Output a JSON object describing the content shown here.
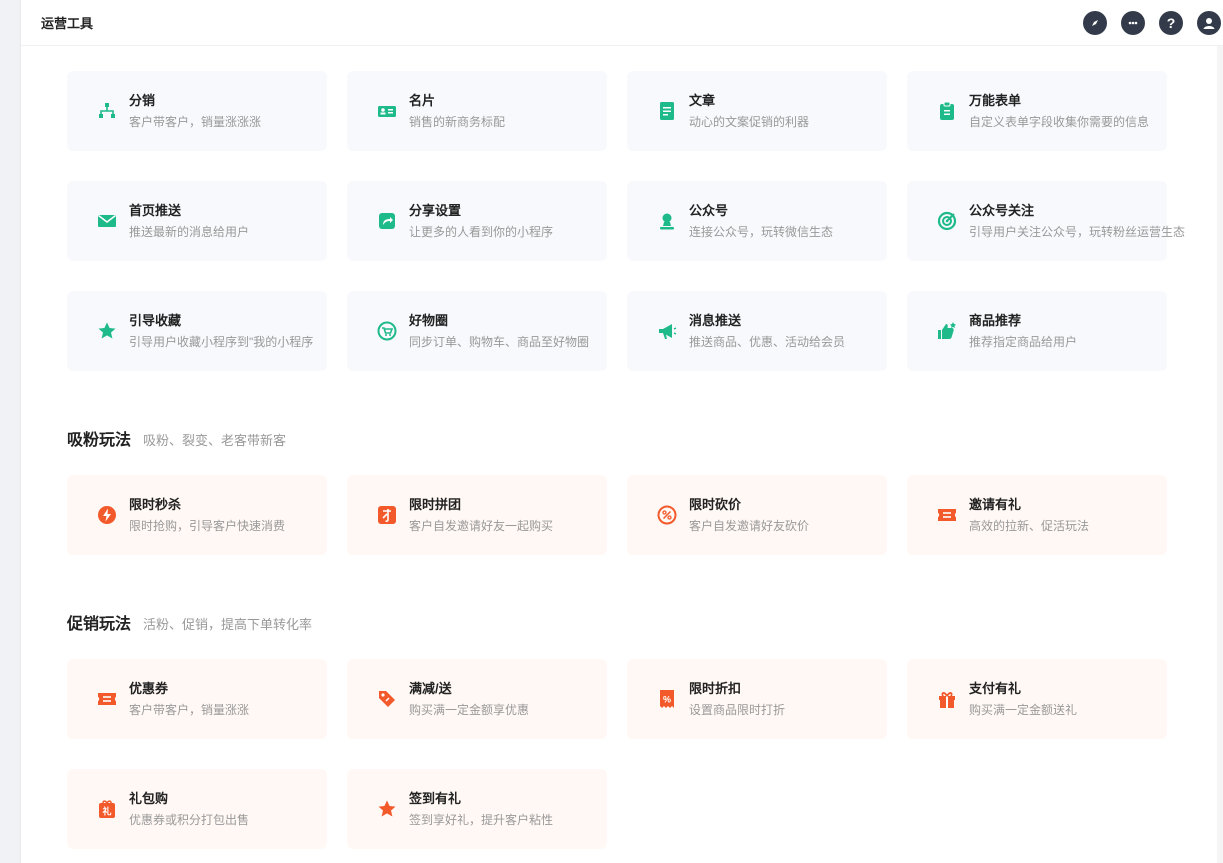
{
  "header": {
    "title": "运营工具"
  },
  "tools": [
    {
      "name": "分销",
      "desc": "客户带客户，销量涨涨涨",
      "icon": "org-chart-icon"
    },
    {
      "name": "名片",
      "desc": "销售的新商务标配",
      "icon": "business-card-icon"
    },
    {
      "name": "文章",
      "desc": "动心的文案促销的利器",
      "icon": "article-icon"
    },
    {
      "name": "万能表单",
      "desc": "自定义表单字段收集你需要的信息",
      "icon": "clipboard-icon"
    },
    {
      "name": "首页推送",
      "desc": "推送最新的消息给用户",
      "icon": "mail-icon"
    },
    {
      "name": "分享设置",
      "desc": "让更多的人看到你的小程序",
      "icon": "share-icon"
    },
    {
      "name": "公众号",
      "desc": "连接公众号，玩转微信生态",
      "icon": "official-account-icon"
    },
    {
      "name": "公众号关注",
      "desc": "引导用户关注公众号，玩转粉丝运营生态",
      "icon": "target-icon"
    },
    {
      "name": "引导收藏",
      "desc": "引导用户收藏小程序到\"我的小程序",
      "icon": "star-icon"
    },
    {
      "name": "好物圈",
      "desc": "同步订单、购物车、商品至好物圈",
      "icon": "cart-circle-icon"
    },
    {
      "name": "消息推送",
      "desc": "推送商品、优惠、活动给会员",
      "icon": "megaphone-icon"
    },
    {
      "name": "商品推荐",
      "desc": "推荐指定商品给用户",
      "icon": "thumbs-up-icon"
    }
  ],
  "fans": {
    "title": "吸粉玩法",
    "subtitle": "吸粉、裂变、老客带新客",
    "items": [
      {
        "name": "限时秒杀",
        "desc": "限时抢购，引导客户快速消费",
        "icon": "lightning-icon"
      },
      {
        "name": "限时拼团",
        "desc": "客户自发邀请好友一起购买",
        "icon": "group-buy-icon"
      },
      {
        "name": "限时砍价",
        "desc": "客户自发邀请好友砍价",
        "icon": "bargain-icon"
      },
      {
        "name": "邀请有礼",
        "desc": "高效的拉新、促活玩法",
        "icon": "ticket-icon"
      }
    ]
  },
  "promo": {
    "title": "促销玩法",
    "subtitle": "活粉、促销，提高下单转化率",
    "items": [
      {
        "name": "优惠券",
        "desc": "客户带客户，销量涨涨",
        "icon": "coupon-icon"
      },
      {
        "name": "满减/送",
        "desc": "购买满一定金额享优惠",
        "icon": "price-tag-icon"
      },
      {
        "name": "限时折扣",
        "desc": "设置商品限时打折",
        "icon": "discount-icon"
      },
      {
        "name": "支付有礼",
        "desc": "购买满一定金额送礼",
        "icon": "gift-icon"
      },
      {
        "name": "礼包购",
        "desc": "优惠券或积分打包出售",
        "icon": "gift-pack-icon"
      },
      {
        "name": "签到有礼",
        "desc": "签到享好礼，提升客户粘性",
        "icon": "checkin-star-icon"
      }
    ]
  },
  "colors": {
    "green": "#1fba8a",
    "orange": "#f35a2b",
    "dark": "#333b4a"
  }
}
